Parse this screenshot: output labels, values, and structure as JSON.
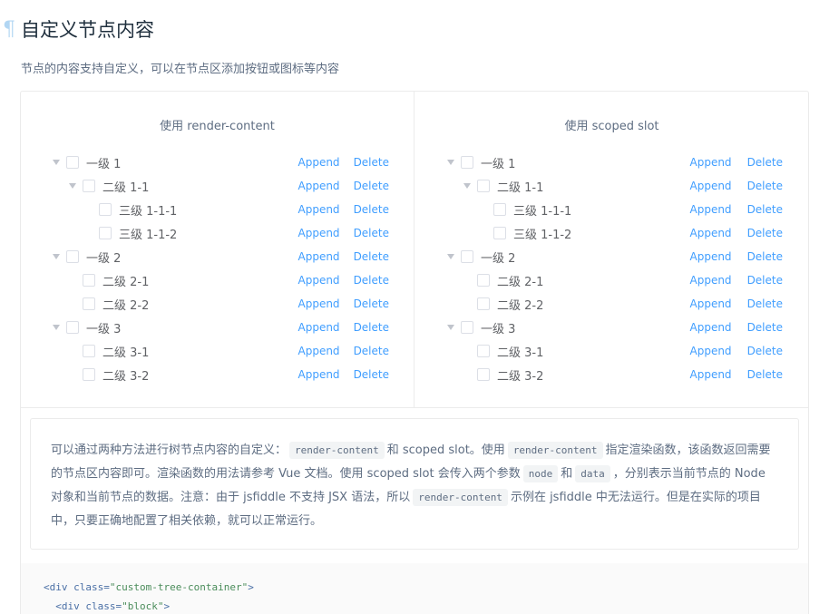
{
  "heading": {
    "anchor": "¶",
    "title": "自定义节点内容"
  },
  "intro": "节点的内容支持自定义，可以在节点区添加按钮或图标等内容",
  "panels": {
    "left_title": "使用 render-content",
    "right_title": "使用 scoped slot"
  },
  "tree": {
    "append_label": "Append",
    "delete_label": "Delete",
    "nodes": [
      {
        "label": "一级 1",
        "level": 1,
        "expanded": true
      },
      {
        "label": "二级 1-1",
        "level": 2,
        "expanded": true
      },
      {
        "label": "三级 1-1-1",
        "level": 3,
        "expanded": false
      },
      {
        "label": "三级 1-1-2",
        "level": 3,
        "expanded": false
      },
      {
        "label": "一级 2",
        "level": 1,
        "expanded": true
      },
      {
        "label": "二级 2-1",
        "level": 2,
        "expanded": false
      },
      {
        "label": "二级 2-2",
        "level": 2,
        "expanded": false
      },
      {
        "label": "一级 3",
        "level": 1,
        "expanded": true
      },
      {
        "label": "二级 3-1",
        "level": 2,
        "expanded": false
      },
      {
        "label": "二级 3-2",
        "level": 2,
        "expanded": false
      }
    ]
  },
  "description": {
    "t1": "可以通过两种方法进行树节点内容的自定义：",
    "c1": "render-content",
    "t2": "和 scoped slot。使用",
    "c2": "render-content",
    "t3": "指定渲染函数，该函数返回需要的节点区内容即可。渲染函数的用法请参考 Vue 文档。使用 scoped slot 会传入两个参数",
    "c3": "node",
    "t4": "和",
    "c4": "data",
    "t5": "，分别表示当前节点的 Node 对象和当前节点的数据。注意：由于 jsfiddle 不支持 JSX 语法，所以",
    "c5": "render-content",
    "t6": "示例在 jsfiddle 中无法运行。但是在实际的项目中，只要正确地配置了相关依赖，就可以正常运行。"
  },
  "code": {
    "line1": {
      "open": "<div ",
      "attr": "class=",
      "val": "\"custom-tree-container\"",
      "close": ">"
    },
    "line2": {
      "indent": "  ",
      "open": "<div ",
      "attr": "class=",
      "val": "\"block\"",
      "close": ">"
    }
  },
  "colors": {
    "link": "#409eff",
    "text": "#606266",
    "muted": "#5e6d82",
    "border": "#ebebeb",
    "anchor": "#b1d6f3"
  }
}
